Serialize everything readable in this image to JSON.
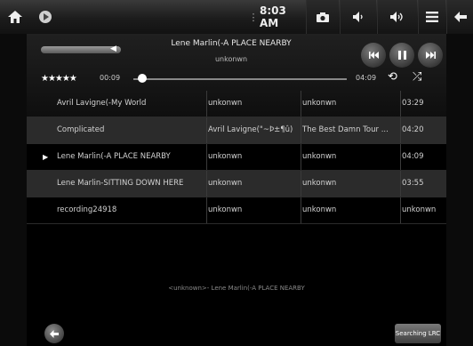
{
  "status_bar": {
    "signal_glyph": "⋮",
    "time": "8:03 AM",
    "icons": [
      "home-icon",
      "app-icon",
      "camera-icon",
      "volume-down-icon",
      "volume-up-icon",
      "menu-icon",
      "back-icon"
    ]
  },
  "now_playing": {
    "title": "Lene Marlin(-A PLACE NEARBY",
    "artist": "unkonwn",
    "rating": "★★★★★",
    "current_time": "00:09",
    "total_time": "04:09",
    "progress_fraction": 0.04
  },
  "tracks": [
    {
      "title": "Avril Lavigne(-My World",
      "artist": "unkonwn",
      "album": "unkonwn",
      "duration": "03:29",
      "playing": false
    },
    {
      "title": "Complicated",
      "artist": "Avril Lavigne(\"~Þ±¶û)",
      "album": "The Best Damn Tour ...",
      "duration": "04:20",
      "playing": false
    },
    {
      "title": "Lene Marlin(-A PLACE NEARBY",
      "artist": "unkonwn",
      "album": "unkonwn",
      "duration": "04:09",
      "playing": true
    },
    {
      "title": "Lene Marlin-SITTING DOWN HERE",
      "artist": "unkonwn",
      "album": "unkonwn",
      "duration": "03:55",
      "playing": false
    },
    {
      "title": "recording24918",
      "artist": "unkonwn",
      "album": "unkonwn",
      "duration": "unkonwn",
      "playing": false
    }
  ],
  "lyrics_line": "<unknown>- Lene Marlin(-A PLACE NEARBY",
  "searching_button_label": "Searching LRC"
}
